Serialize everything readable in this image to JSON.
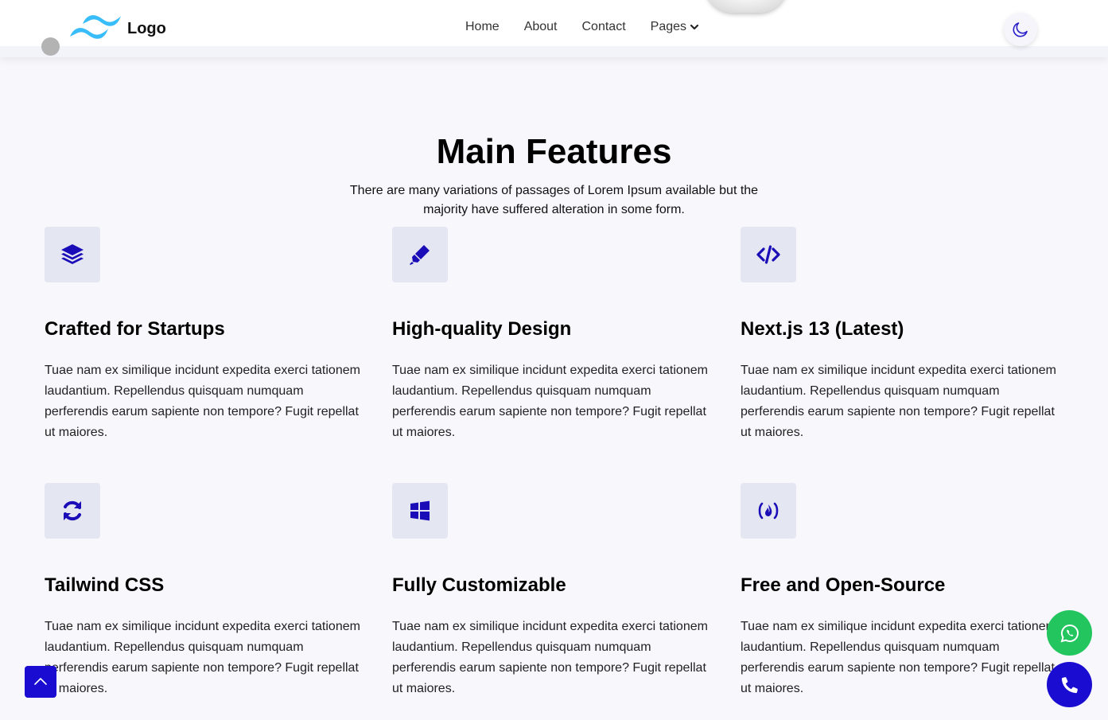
{
  "header": {
    "logo_text": "Logo",
    "nav": [
      {
        "label": "Home"
      },
      {
        "label": "About"
      },
      {
        "label": "Contact"
      },
      {
        "label": "Pages"
      }
    ]
  },
  "section": {
    "title": "Main Features",
    "subtitle": "There are many variations of passages of Lorem Ipsum available but the majority have suffered alteration in some form."
  },
  "features": [
    {
      "icon": "layers-icon",
      "title": "Crafted for Startups",
      "desc": "Tuae nam ex similique incidunt expedita exerci tationem laudantium. Repellendus quisquam numquam perferendis earum sapiente non tempore? Fugit repellat ut maiores."
    },
    {
      "icon": "highlighter-icon",
      "title": "High-quality Design",
      "desc": "Tuae nam ex similique incidunt expedita exerci tationem laudantium. Repellendus quisquam numquam perferendis earum sapiente non tempore? Fugit repellat ut maiores."
    },
    {
      "icon": "code-icon",
      "title": "Next.js 13 (Latest)",
      "desc": "Tuae nam ex similique incidunt expedita exerci tationem laudantium. Repellendus quisquam numquam perferendis earum sapiente non tempore? Fugit repellat ut maiores."
    },
    {
      "icon": "sync-icon",
      "title": "Tailwind CSS",
      "desc": "Tuae nam ex similique incidunt expedita exerci tationem laudantium. Repellendus quisquam numquam perferendis earum sapiente non tempore? Fugit repellat ut maiores."
    },
    {
      "icon": "windows-icon",
      "title": "Fully Customizable",
      "desc": "Tuae nam ex similique incidunt expedita exerci tationem laudantium. Repellendus quisquam numquam perferendis earum sapiente non tempore? Fugit repellat ut maiores."
    },
    {
      "icon": "free-code-camp-icon",
      "title": "Free and Open-Source",
      "desc": "Tuae nam ex similique incidunt expedita exerci tationem laudantium. Repellendus quisquam numquam perferendis earum sapiente non tempore? Fugit repellat ut maiores."
    }
  ],
  "colors": {
    "accent": "#1a0dd1",
    "icon_bg": "#e4e6f1",
    "page_bg": "#f7f7fc",
    "whatsapp": "#22c55e",
    "logo_blue": "#38bdf8"
  },
  "floating": {
    "scroll_top_icon": "chevron-up-icon",
    "whatsapp_icon": "whatsapp-icon",
    "phone_icon": "phone-icon"
  }
}
